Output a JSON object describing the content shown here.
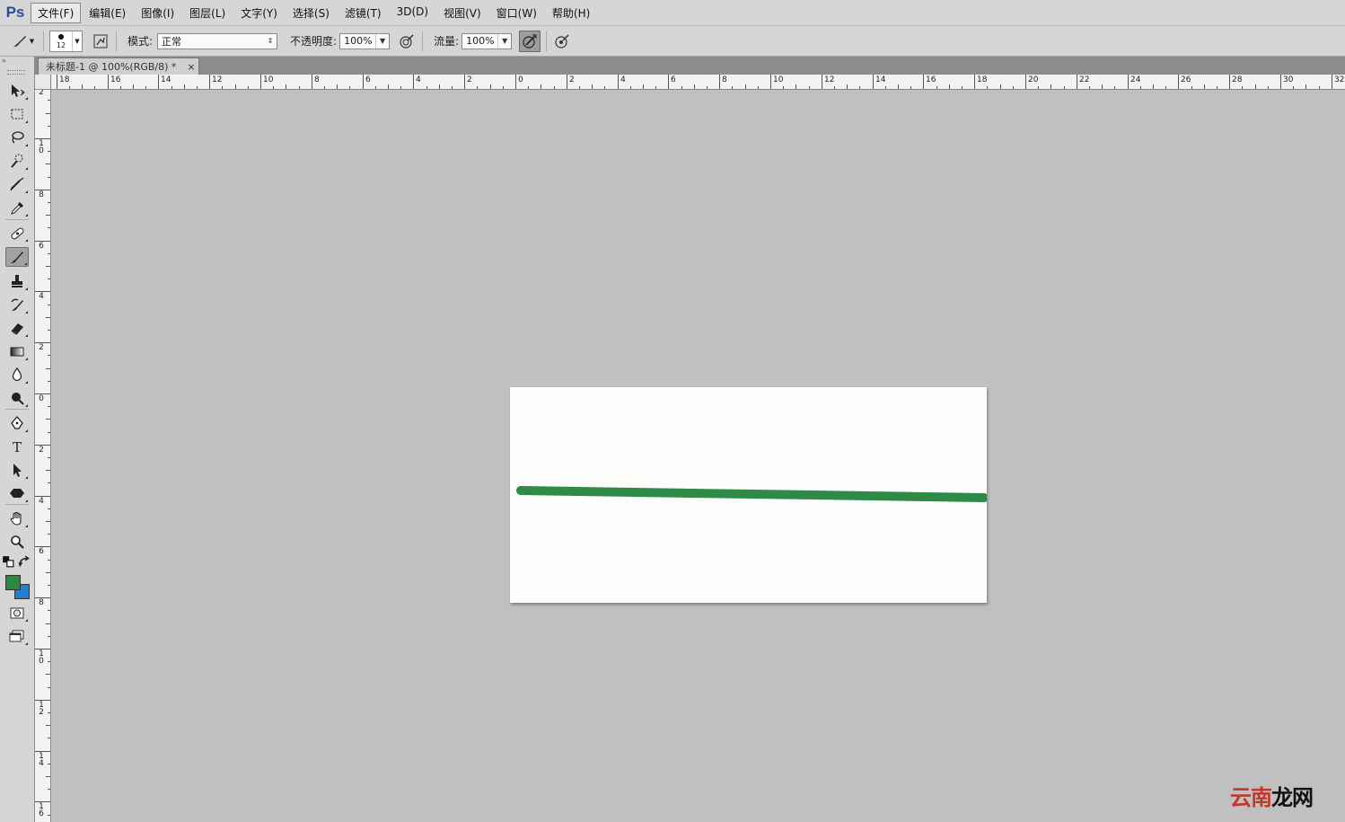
{
  "app": {
    "logo": "Ps"
  },
  "menu": [
    {
      "label": "文件(F)",
      "active": true
    },
    {
      "label": "编辑(E)"
    },
    {
      "label": "图像(I)"
    },
    {
      "label": "图层(L)"
    },
    {
      "label": "文字(Y)"
    },
    {
      "label": "选择(S)"
    },
    {
      "label": "滤镜(T)"
    },
    {
      "label": "3D(D)"
    },
    {
      "label": "视图(V)"
    },
    {
      "label": "窗口(W)"
    },
    {
      "label": "帮助(H)"
    }
  ],
  "options": {
    "brush_size": "12",
    "mode_label": "模式:",
    "mode_value": "正常",
    "opacity_label": "不透明度:",
    "opacity_value": "100%",
    "flow_label": "流量:",
    "flow_value": "100%"
  },
  "document": {
    "tab_title": "未标题-1 @ 100%(RGB/8) *",
    "close_glyph": "×"
  },
  "rulers": {
    "h_labels": [
      "18",
      "16",
      "14",
      "12",
      "10",
      "8",
      "6",
      "4",
      "2",
      "0",
      "2",
      "4",
      "6",
      "8",
      "10",
      "12",
      "14",
      "16",
      "18",
      "20",
      "22",
      "24",
      "26",
      "28",
      "30",
      "32"
    ],
    "v_labels": [
      "2",
      "10",
      "8",
      "6",
      "4",
      "2",
      "0",
      "2",
      "4",
      "6",
      "8",
      "10",
      "12",
      "14",
      "16"
    ]
  },
  "tools": [
    {
      "name": "move-tool",
      "icon": "move-icon"
    },
    {
      "name": "marquee-tool",
      "icon": "rect-marquee-icon"
    },
    {
      "name": "lasso-tool",
      "icon": "lasso-icon"
    },
    {
      "name": "quick-select-tool",
      "icon": "quick-select-icon"
    },
    {
      "name": "crop-tool",
      "icon": "crop-icon"
    },
    {
      "name": "eyedropper-tool",
      "icon": "eyedropper-icon"
    },
    {
      "name": "healing-tool",
      "icon": "bandage-icon"
    },
    {
      "name": "brush-tool",
      "icon": "brush-icon",
      "selected": true
    },
    {
      "name": "clone-stamp-tool",
      "icon": "stamp-icon"
    },
    {
      "name": "history-brush-tool",
      "icon": "history-brush-icon"
    },
    {
      "name": "eraser-tool",
      "icon": "eraser-icon"
    },
    {
      "name": "gradient-tool",
      "icon": "gradient-icon"
    },
    {
      "name": "blur-tool",
      "icon": "drop-icon"
    },
    {
      "name": "dodge-tool",
      "icon": "dodge-icon"
    },
    {
      "name": "pen-tool",
      "icon": "pen-icon"
    },
    {
      "name": "type-tool",
      "icon": "type-icon"
    },
    {
      "name": "path-select-tool",
      "icon": "arrow-icon"
    },
    {
      "name": "shape-tool",
      "icon": "hexagon-icon"
    },
    {
      "name": "hand-tool",
      "icon": "hand-icon"
    },
    {
      "name": "zoom-tool",
      "icon": "zoom-icon"
    }
  ],
  "colors": {
    "foreground": "#2a8a45",
    "background": "#1f7fd0",
    "stroke": "#2e8b47",
    "accent": "#2b4f8e"
  },
  "watermark": {
    "part1": "云南",
    "part2": "龙网"
  }
}
